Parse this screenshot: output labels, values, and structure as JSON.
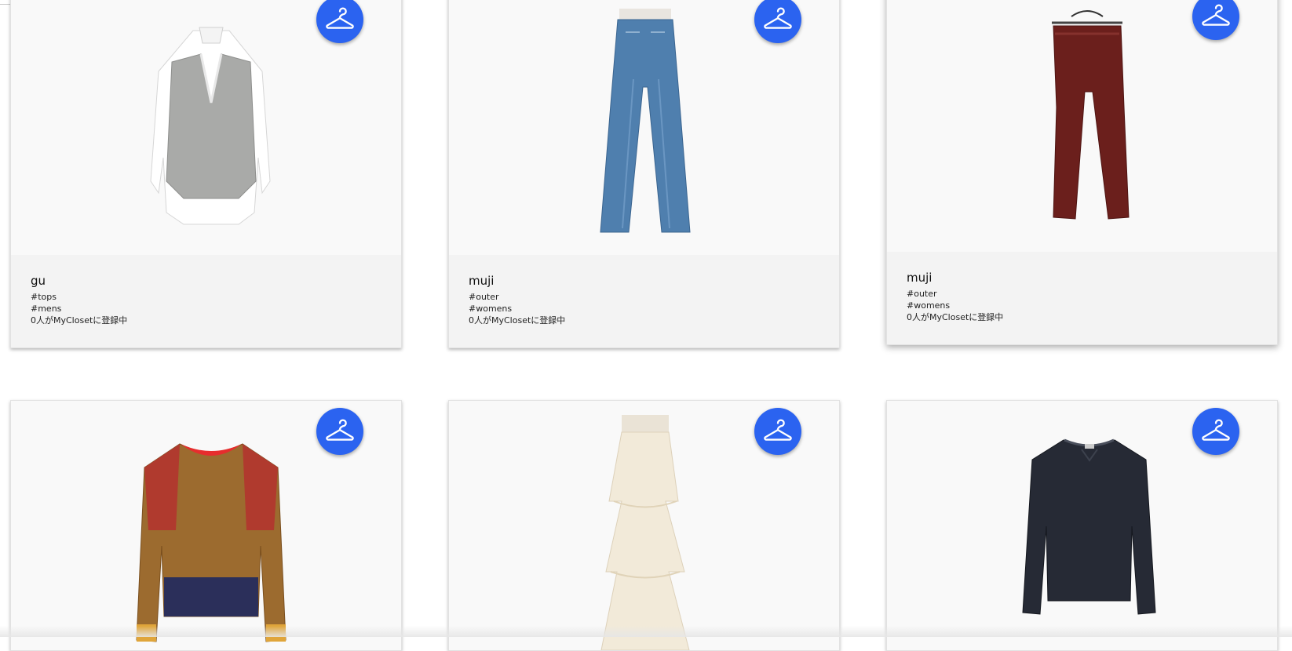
{
  "products": [
    {
      "brand": "gu",
      "category": "#tops",
      "gender": "#mens",
      "registered": "0人がMyClosetに登録中",
      "item": "vest-over-shirt"
    },
    {
      "brand": "muji",
      "category": "#outer",
      "gender": "#womens",
      "registered": "0人がMyClosetに登録中",
      "item": "denim-jeans"
    },
    {
      "brand": "muji",
      "category": "#outer",
      "gender": "#womens",
      "registered": "0人がMyClosetに登録中",
      "item": "burgundy-pants"
    },
    {
      "brand": "",
      "category": "",
      "gender": "",
      "registered": "",
      "item": "mohair-sweater"
    },
    {
      "brand": "",
      "category": "",
      "gender": "",
      "registered": "",
      "item": "tiered-skirt"
    },
    {
      "brand": "",
      "category": "",
      "gender": "",
      "registered": "",
      "item": "navy-sweatshirt"
    }
  ],
  "colors": {
    "accent": "#2b63f0",
    "card_bg": "#f9f9f9",
    "info_bg": "#f3f3f3"
  },
  "icons": {
    "closet_button": "hanger-icon"
  }
}
